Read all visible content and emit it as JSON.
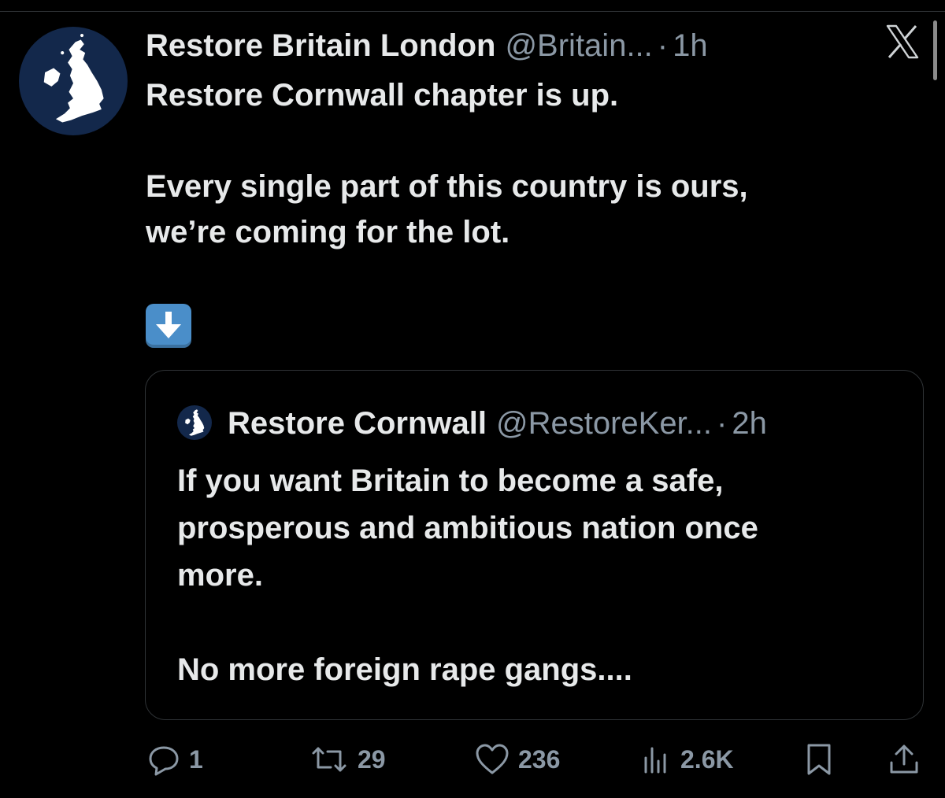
{
  "tweet": {
    "display_name": "Restore Britain London",
    "handle": "@Britain...",
    "separator": "·",
    "time": "1h",
    "text_line_1": "Restore Cornwall chapter is up.",
    "text_line_2": "Every single part of this country is ours,",
    "text_line_3": "we’re coming for the lot.",
    "emoji": "down-arrow-emoji"
  },
  "quoted_tweet": {
    "display_name": "Restore Cornwall",
    "handle": "@RestoreKer...",
    "separator": "·",
    "time": "2h",
    "text_line_1": "If you want Britain to become a safe,",
    "text_line_2": "prosperous and ambitious nation once",
    "text_line_3": "more.",
    "text_line_4": "No more foreign rape gangs...."
  },
  "actions": {
    "replies": "1",
    "reposts": "29",
    "likes": "236",
    "views": "2.6K"
  },
  "icons": {
    "avatar": "uk-map-icon",
    "close": "x-logo-icon",
    "reply": "reply-icon",
    "repost": "repost-icon",
    "like": "heart-icon",
    "views": "views-icon",
    "bookmark": "bookmark-icon",
    "share": "share-icon"
  },
  "colors": {
    "background": "#000000",
    "text": "#e7e9ea",
    "muted": "#8b98a5",
    "avatar_bg": "#13284b",
    "emoji_bg": "#4a8ec9"
  }
}
